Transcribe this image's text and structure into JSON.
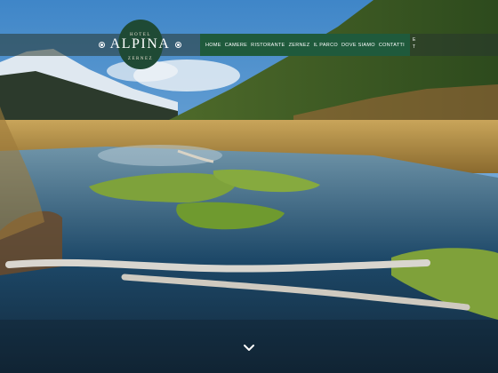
{
  "logo": {
    "top_text": "HOTEL",
    "name": "ALPINA",
    "bottom_text": "ZERNEZ",
    "badge_color": "#1f4a35"
  },
  "nav": {
    "color": "#1f5a3c",
    "items": [
      {
        "label": "HOME"
      },
      {
        "label": "CAMERE"
      },
      {
        "label": "RISTORANTE"
      },
      {
        "label": "ZERNEZ"
      },
      {
        "label": "IL PARCO"
      },
      {
        "label": "DOVE SIAMO"
      },
      {
        "label": "CONTATTI"
      }
    ],
    "language_line1": "E",
    "language_line2": "T"
  },
  "icons": {
    "scroll": "chevron-down-icon",
    "ornament": "flower-ornament-icon"
  }
}
